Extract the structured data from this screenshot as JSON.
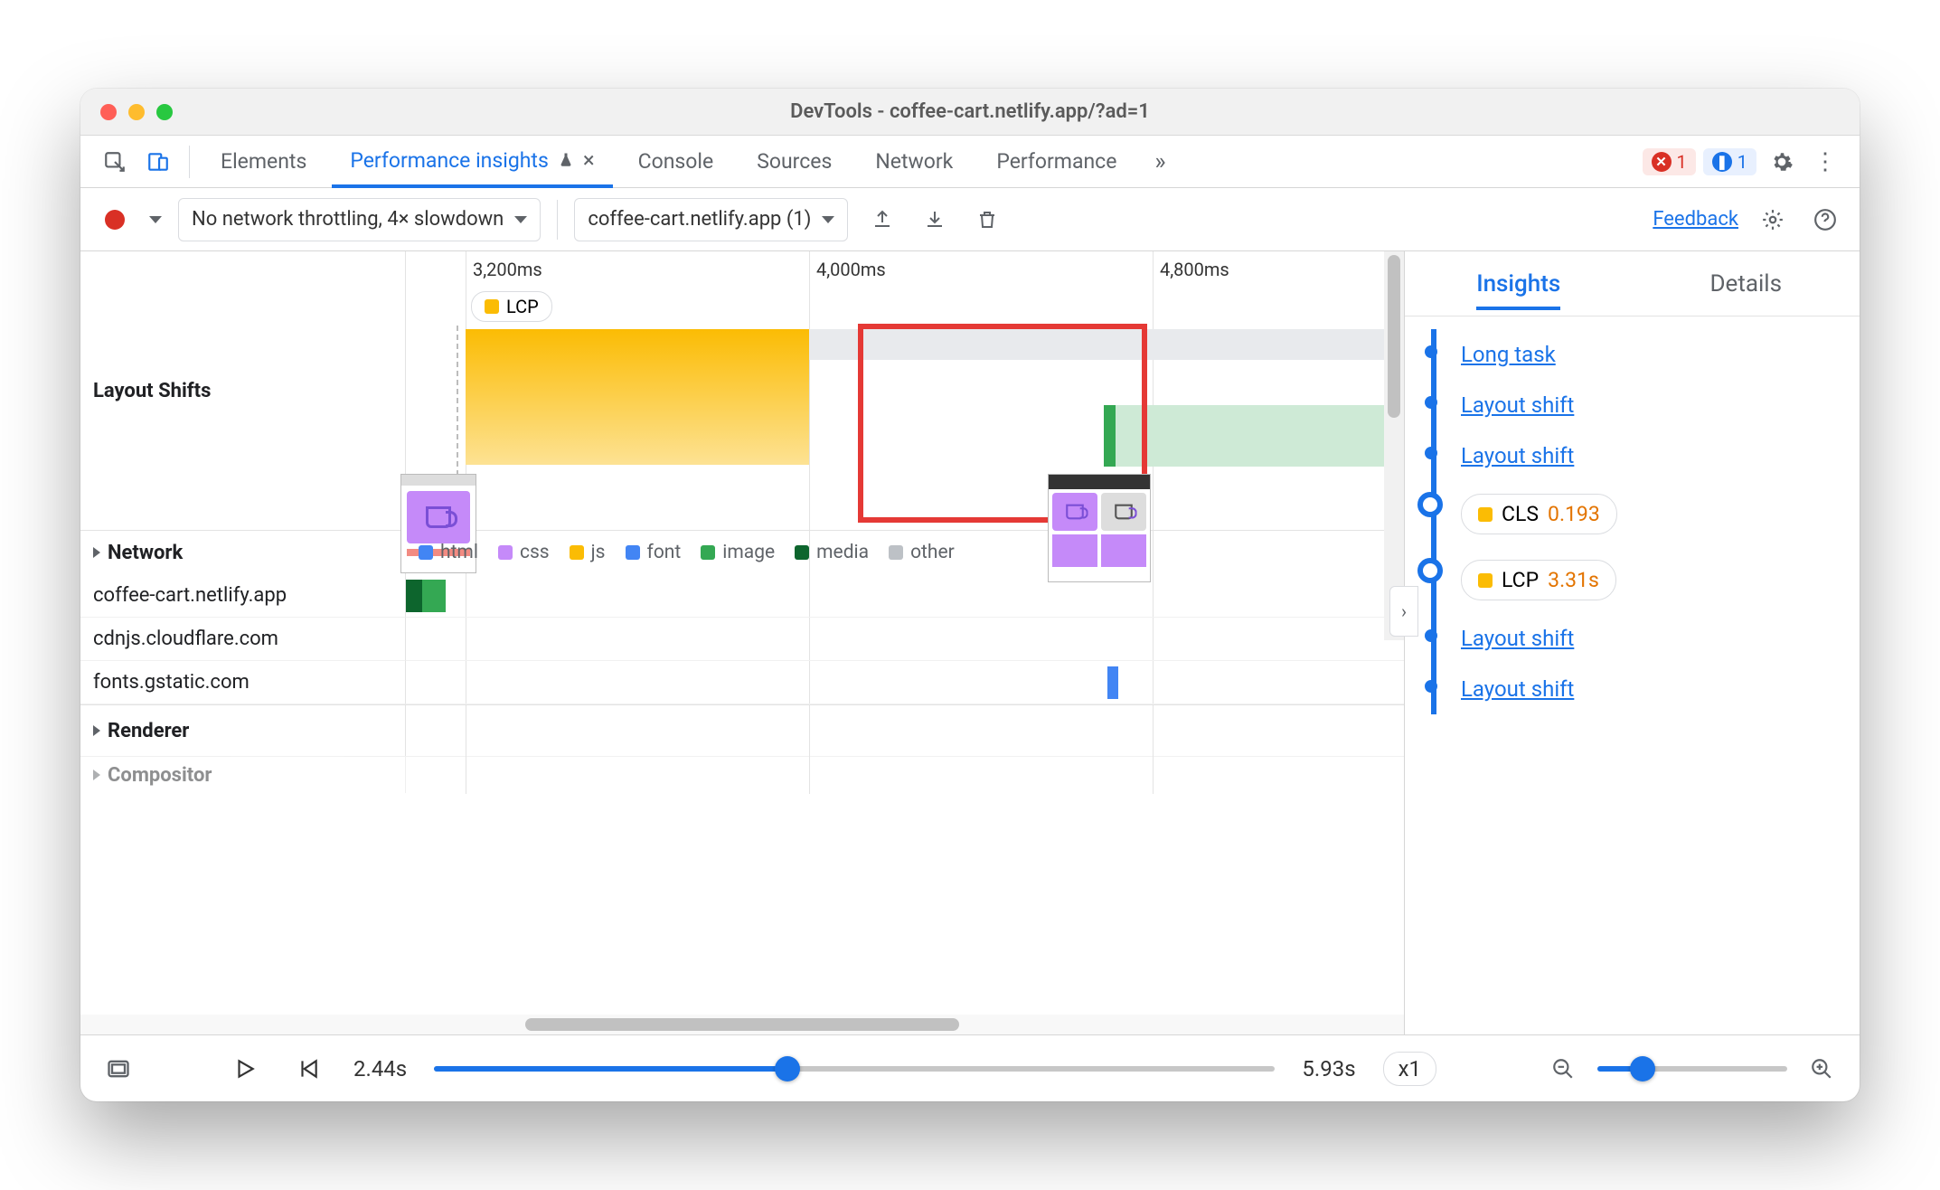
{
  "window": {
    "title": "DevTools - coffee-cart.netlify.app/?ad=1"
  },
  "tabs": {
    "elements": "Elements",
    "perf_insights": "Performance insights",
    "console": "Console",
    "sources": "Sources",
    "network": "Network",
    "performance": "Performance"
  },
  "badges": {
    "error_count": "1",
    "issue_count": "1"
  },
  "toolbar": {
    "throttle": "No network throttling, 4× slowdown",
    "page": "coffee-cart.netlify.app (1)",
    "feedback": "Feedback"
  },
  "ruler": {
    "t1": "3,200ms",
    "t2": "4,000ms",
    "t3": "4,800ms"
  },
  "lcp_pill": "LCP",
  "sections": {
    "layout_shifts": "Layout Shifts",
    "network": "Network",
    "renderer": "Renderer",
    "compositor": "Compositor"
  },
  "legend": {
    "html": "html",
    "css": "css",
    "js": "js",
    "font": "font",
    "image": "image",
    "media": "media",
    "other": "other"
  },
  "hosts": {
    "h1": "coffee-cart.netlify.app",
    "h2": "cdnjs.cloudflare.com",
    "h3": "fonts.gstatic.com"
  },
  "right": {
    "insights_tab": "Insights",
    "details_tab": "Details",
    "long_task": "Long task",
    "layout_shift": "Layout shift",
    "cls_label": "CLS",
    "cls_val": "0.193",
    "lcp_label": "LCP",
    "lcp_val": "3.31s"
  },
  "footer": {
    "start": "2.44s",
    "end": "5.93s",
    "speed": "x1"
  }
}
